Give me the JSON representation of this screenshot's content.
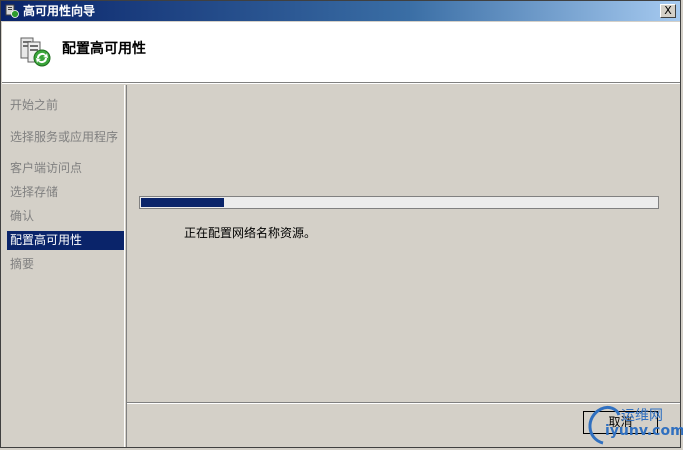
{
  "window": {
    "title": "高可用性向导",
    "close_label": "X"
  },
  "header": {
    "title": "配置高可用性"
  },
  "sidebar": {
    "steps": [
      {
        "label": "开始之前",
        "state": "disabled"
      },
      {
        "label": "选择服务或应用程序",
        "state": "disabled"
      },
      {
        "label": "客户端访问点",
        "state": "disabled"
      },
      {
        "label": "选择存储",
        "state": "disabled"
      },
      {
        "label": "确认",
        "state": "disabled"
      },
      {
        "label": "配置高可用性",
        "state": "active"
      },
      {
        "label": "摘要",
        "state": "disabled"
      }
    ]
  },
  "main": {
    "progress_fraction": 0.16,
    "status_text": "正在配置网络名称资源。"
  },
  "footer": {
    "cancel_label": "取消"
  },
  "watermark": {
    "line1": "运维网",
    "line2": "iyunv.com"
  },
  "colors": {
    "selection": "#0a246a",
    "progress": "#0a246a",
    "watermark": "#3070c0"
  }
}
